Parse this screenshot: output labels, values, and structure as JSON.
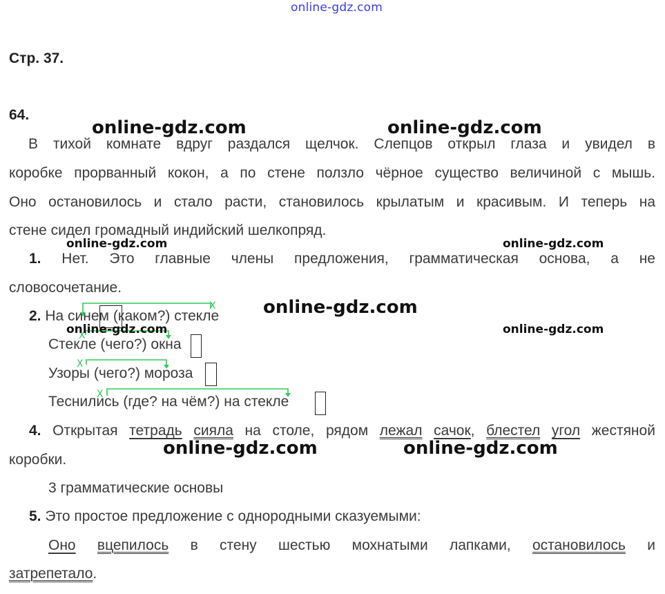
{
  "watermark_top": "online-gdz.com",
  "watermark": "online-gdz.com",
  "page_label": "Стр. 37.",
  "exercise_number": "64.",
  "paragraph": [
    "В тихой комнате вдруг раздался щелчок. Слепцов открыл глаза и увидел в",
    "коробке прорванный кокон, а по стене ползло чёрное существо величиной с мышь.",
    "Оно остановилось и стало расти, становилось крылатым и красивым. И теперь на",
    "стене сидел громадный индийский шелкопряд."
  ],
  "answer1": {
    "num": "1.",
    "line1": "Нет. Это главные члены предложения, грамматическая основа, а не",
    "line2": "словосочетание."
  },
  "answer2": {
    "num": "2.",
    "p1a": "На син",
    "p1b": "ем",
    "p1c": " (каком?) стекле",
    "p2a": "Стекле (чего?) окн",
    "p2b": "а",
    "p3a": "Узоры (чего?) мороз",
    "p3b": "а",
    "p4a": "Теснились (где? на чём?) на стекл",
    "p4b": "е",
    "mark_x": "X"
  },
  "answer4": {
    "num": "4.",
    "w1": "Открытая",
    "w2": "тетрадь",
    "w3": "сияла",
    "w4": "на столе, рядом",
    "w5": "лежал",
    "w6": "сачок",
    "w7": ",",
    "w8": "блестел",
    "w9": "угол",
    "w10": "жестяной",
    "line2": "коробки.",
    "note": "3 грамматические основы"
  },
  "answer5": {
    "num": "5.",
    "text": "Это простое предложение с однородными сказуемыми:",
    "w1": "Оно",
    "w2": "вцепилось",
    "w3": "в",
    "w4": "стену",
    "w5": "шестью",
    "w6": "мохнатыми",
    "w7": "лапками,",
    "w8": "остановилось",
    "w9": "и",
    "w10": "затрепетало",
    "w11": "."
  },
  "colors": {
    "arrow_green": "#2ecc55",
    "watermark_top": "#3b3be0",
    "text": "#3a3a3a"
  }
}
